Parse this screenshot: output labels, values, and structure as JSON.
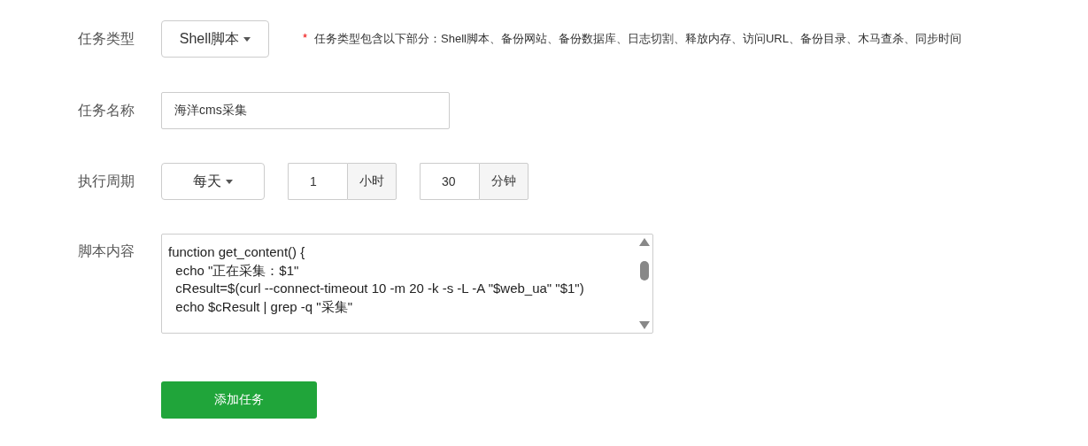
{
  "task_type": {
    "label": "任务类型",
    "value": "Shell脚本"
  },
  "hint": {
    "mark": "*",
    "text": "任务类型包含以下部分：Shell脚本、备份网站、备份数据库、日志切割、释放内存、访问URL、备份目录、木马查杀、同步时间"
  },
  "task_name": {
    "label": "任务名称",
    "value": "海洋cms采集"
  },
  "period": {
    "label": "执行周期",
    "value": "每天",
    "hour": {
      "value": "1",
      "unit": "小时"
    },
    "minute": {
      "value": "30",
      "unit": "分钟"
    }
  },
  "script": {
    "label": "脚本内容",
    "lines": [
      "function get_content() {",
      "  echo \"正在采集：$1\"",
      "  cResult=$(curl --connect-timeout 10 -m 20 -k -s -L -A \"$web_ua\" \"$1\")",
      "  echo $cResult | grep -q \"采集\""
    ]
  },
  "submit_button": "添加任务"
}
